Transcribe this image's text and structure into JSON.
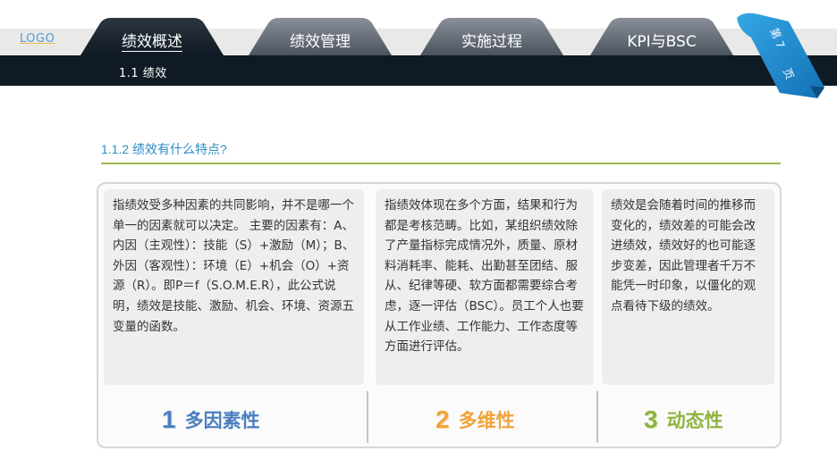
{
  "logo": "LOGO",
  "tabs": [
    {
      "label": "绩效概述",
      "active": true
    },
    {
      "label": "绩效管理",
      "active": false
    },
    {
      "label": "实施过程",
      "active": false
    },
    {
      "label": "KPI与BSC",
      "active": false
    }
  ],
  "subnav": {
    "label": "1.1  绩效"
  },
  "page_indicator": {
    "line1": "第 7",
    "line2": "页"
  },
  "section": {
    "title": "1.1.2 绩效有什么特点?"
  },
  "features": [
    {
      "number": "1",
      "title": "多因素性",
      "color": "#4a7fbf",
      "text": "指绩效受多种因素的共同影响，并不是哪一个单一的因素就可以决定。 主要的因素有：A、内因（主观性）：技能（S）+激励（M）；B、外因（客观性）：环境（E）+机会（O）+资源（R）。即P＝f（S.O.M.E.R），此公式说明，绩效是技能、激励、机会、环境、资源五变量的函数。"
    },
    {
      "number": "2",
      "title": "多维性",
      "color": "#f0a33a",
      "text": "指绩效体现在多个方面，结果和行为都是考核范畴。比如，某组织绩效除了产量指标完成情况外，质量、原材料消耗率、能耗、出勤甚至团结、服从、纪律等硬、软方面都需要综合考虑，逐一评估（BSC）。员工个人也要从工作业绩、工作能力、工作态度等方面进行评估。"
    },
    {
      "number": "3",
      "title": "动态性",
      "color": "#8fb33e",
      "text": "绩效是会随着时间的推移而变化的，绩效差的可能会改进绩效，绩效好的也可能逐步变差，因此管理者千万不能凭一时印象，以僵化的观点看待下级的绩效。"
    }
  ]
}
